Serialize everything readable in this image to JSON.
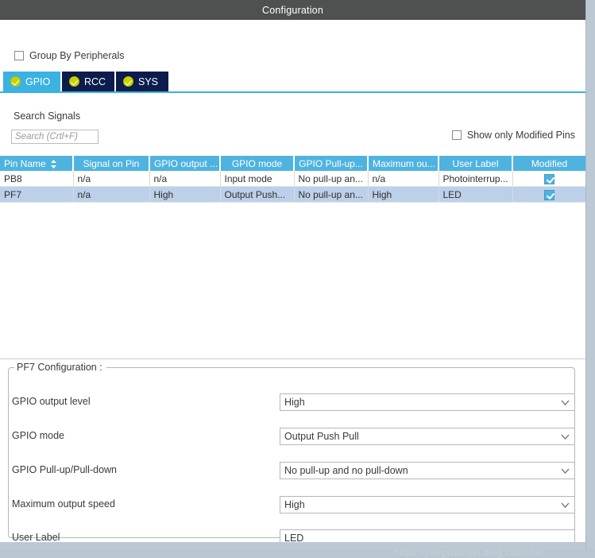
{
  "window": {
    "title": "Configuration"
  },
  "options": {
    "group_by_peripherals_label": "Group By Peripherals",
    "group_by_peripherals_checked": false,
    "show_only_modified_label": "Show only Modified Pins",
    "show_only_modified_checked": false
  },
  "tabs": [
    {
      "label": "GPIO",
      "active": true,
      "status_icon": "check-circle-icon"
    },
    {
      "label": "RCC",
      "active": false,
      "status_icon": "check-circle-icon"
    },
    {
      "label": "SYS",
      "active": false,
      "status_icon": "check-circle-icon"
    }
  ],
  "search": {
    "label": "Search Signals",
    "placeholder": "Search (Crtl+F)",
    "value": ""
  },
  "table": {
    "columns": [
      {
        "label": "Pin Name",
        "sorted": true,
        "sort_icon": "sort-updown-icon",
        "align": "left"
      },
      {
        "label": "Signal on Pin",
        "align": "center"
      },
      {
        "label": "GPIO output ...",
        "align": "center"
      },
      {
        "label": "GPIO mode",
        "align": "center"
      },
      {
        "label": "GPIO Pull-up...",
        "align": "center"
      },
      {
        "label": "Maximum ou...",
        "align": "center"
      },
      {
        "label": "User Label",
        "align": "center"
      },
      {
        "label": "Modified",
        "align": "center"
      }
    ],
    "rows": [
      {
        "selected": false,
        "pin_name": "PB8",
        "signal_on_pin": "n/a",
        "gpio_output": "n/a",
        "gpio_mode": "Input mode",
        "gpio_pullup": "No pull-up an...",
        "max_output": "n/a",
        "user_label": "Photointerrup...",
        "modified": true
      },
      {
        "selected": true,
        "pin_name": "PF7",
        "signal_on_pin": "n/a",
        "gpio_output": "High",
        "gpio_mode": "Output Push...",
        "gpio_pullup": "No pull-up an...",
        "max_output": "High",
        "user_label": "LED",
        "modified": true
      }
    ]
  },
  "config": {
    "legend": "PF7 Configuration :",
    "fields": [
      {
        "label": "GPIO output level",
        "value": "High",
        "type": "dropdown"
      },
      {
        "label": "GPIO mode",
        "value": "Output Push Pull",
        "type": "dropdown"
      },
      {
        "label": "GPIO Pull-up/Pull-down",
        "value": "No pull-up and no pull-down",
        "type": "dropdown"
      },
      {
        "label": "Maximum output speed",
        "value": "High",
        "type": "dropdown"
      },
      {
        "label": "User Label",
        "value": "LED",
        "type": "text"
      }
    ]
  },
  "watermark": {
    "text": "https://yangyuanxin.blog.csdn.net"
  },
  "colors": {
    "titlebar": "#4f5050",
    "accent": "#3ab2e3",
    "tab_inactive": "#0c1c4c",
    "header": "#4fb3e0",
    "row_selected": "#bdd0e9",
    "panel": "#bcc8d3"
  }
}
